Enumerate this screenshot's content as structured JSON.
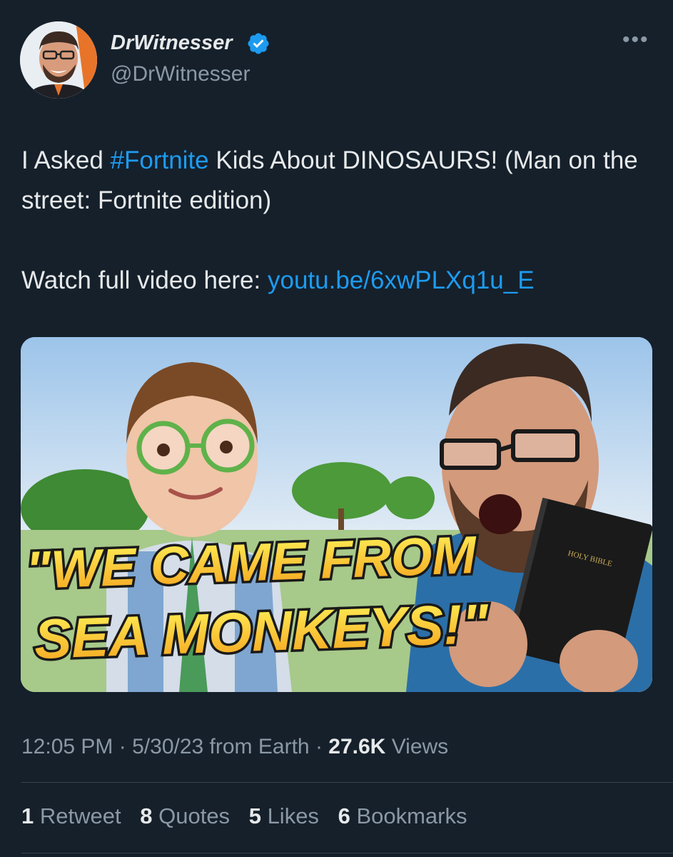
{
  "author": {
    "name": "DrWitnesser",
    "handle": "@DrWitnesser",
    "verified": true
  },
  "tweet": {
    "line1_pre": "I Asked ",
    "hashtag": "#Fortnite",
    "line1_post": " Kids About DINOSAURS! (Man on the street: Fortnite edition)",
    "watch_text": "Watch full video here: ",
    "link": "youtu.be/6xwPLXq1u_E"
  },
  "media": {
    "caption_line1": "\"WE CAME FROM",
    "caption_line2": "SEA MONKEYS!\"",
    "book_label": "HOLY BIBLE"
  },
  "meta": {
    "time": "12:05 PM",
    "date": "5/30/23",
    "source": "from Earth",
    "views_count": "27.6K",
    "views_label": "Views"
  },
  "stats": {
    "retweets_count": "1",
    "retweets_label": "Retweet",
    "quotes_count": "8",
    "quotes_label": "Quotes",
    "likes_count": "5",
    "likes_label": "Likes",
    "bookmarks_count": "6",
    "bookmarks_label": "Bookmarks"
  },
  "colors": {
    "background": "#15202b",
    "link": "#1d9bf0",
    "muted": "#8b98a5",
    "verified": "#1d9bf0"
  },
  "icons": [
    "verified-icon",
    "more-icon"
  ]
}
